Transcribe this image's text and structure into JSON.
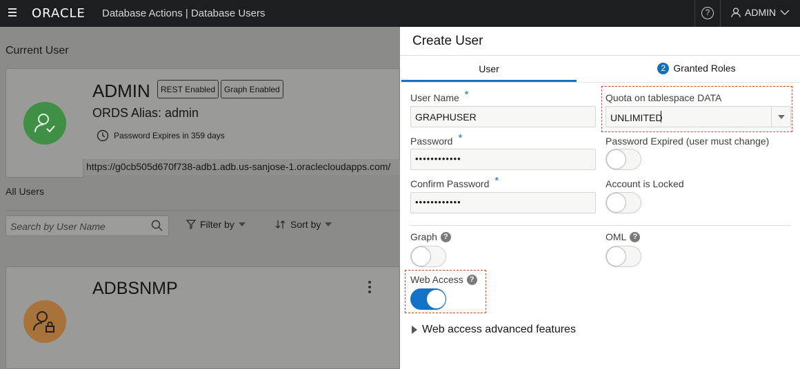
{
  "topbar": {
    "logo": "ORACLE",
    "app_title": "Database Actions  |  Database Users",
    "help_glyph": "?",
    "user": "ADMIN"
  },
  "left": {
    "current_user_label": "Current User",
    "admin": {
      "name": "ADMIN",
      "badges": [
        "REST Enabled",
        "Graph Enabled"
      ],
      "alias": "ORDS Alias: admin",
      "password_expires": "Password Expires in 359 days",
      "url": "https://g0cb505d670f738-adb1.adb.us-sanjose-1.oraclecloudapps.com/"
    },
    "all_users_label": "All Users",
    "search_placeholder": "Search by User Name",
    "filter_label": "Filter by",
    "sort_label": "Sort by",
    "user_card_name": "ADBSNMP",
    "colors": {
      "admin_avatar": "#3f8f45",
      "adbsnmp_avatar": "#a8733a"
    }
  },
  "panel": {
    "title": "Create User",
    "tabs": {
      "user": "User",
      "roles": "Granted Roles",
      "roles_count": "2"
    },
    "fields": {
      "username_label": "User Name",
      "username_value": "GRAPHUSER",
      "password_label": "Password",
      "password_value": "••••••••••••",
      "confirm_label": "Confirm Password",
      "confirm_value": "••••••••••••",
      "quota_label": "Quota on tablespace DATA",
      "quota_value": "UNLIMITED",
      "pw_expired_label": "Password Expired (user must change)",
      "locked_label": "Account is Locked",
      "graph_label": "Graph",
      "oml_label": "OML",
      "web_access_label": "Web Access",
      "required_mark": "*",
      "help_glyph": "?"
    },
    "toggles": {
      "pw_expired": false,
      "locked": false,
      "graph": false,
      "oml": false,
      "web_access": true
    },
    "advanced_label": "Web access advanced features",
    "colors": {
      "accent": "#1272c6",
      "highlight": "#d9452b"
    }
  }
}
